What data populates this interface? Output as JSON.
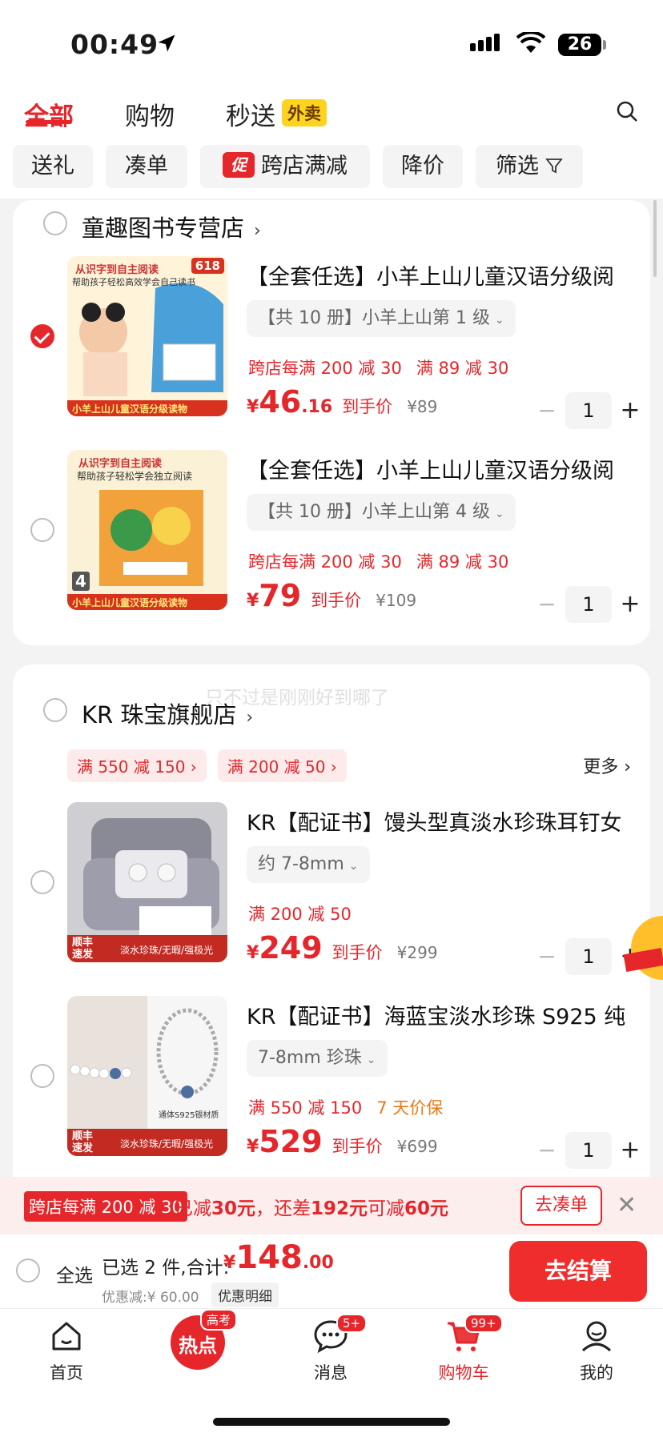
{
  "status_bar": {
    "time": "00:49",
    "battery": "26"
  },
  "tabs": [
    {
      "label": "全部",
      "active": true
    },
    {
      "label": "购物",
      "active": false
    },
    {
      "label": "秒送",
      "active": false
    }
  ],
  "waimai_badge": "外卖",
  "filters": [
    "送礼",
    "凑单",
    "跨店满减",
    "降价",
    "筛选"
  ],
  "promo_icon": "促",
  "watermark": "只不过是刚刚好到哪了",
  "shops": [
    {
      "name": "童趣图书专营店",
      "products": [
        {
          "checked": true,
          "title": "【全套任选】小羊上山儿童汉语分级阅",
          "spec": "【共 10 册】小羊上山第 1 级",
          "promo": "跨店每满 200 减 30",
          "promo2": "满 89 减 30",
          "price_yen": "¥",
          "price_int": "46",
          "price_dec": ".16",
          "price_label": "到手价",
          "orig_price": "¥89",
          "qty": "1",
          "thumb_badge": "618",
          "thumb_top": "从识字到自主阅读",
          "thumb_sub": "帮助孩子轻松高效学会自己读书",
          "thumb_banner": "小羊上山儿童汉语分级读物"
        },
        {
          "checked": false,
          "title": "【全套任选】小羊上山儿童汉语分级阅",
          "spec": "【共 10 册】小羊上山第 4 级",
          "promo": "跨店每满 200 减 30",
          "promo2": "满 89 减 30",
          "price_yen": "¥",
          "price_int": "79",
          "price_dec": "",
          "price_label": "到手价",
          "orig_price": "¥109",
          "qty": "1",
          "thumb_top": "从识字到自主阅读",
          "thumb_sub": "帮助孩子轻松学会独立阅读",
          "thumb_level": "4",
          "thumb_banner": "小羊上山儿童汉语分级读物"
        }
      ]
    },
    {
      "name": "KR 珠宝旗舰店",
      "coupons": [
        "满 550 减 150",
        "满 200 减 50"
      ],
      "more": "更多",
      "products": [
        {
          "checked": false,
          "title": "KR【配证书】馒头型真淡水珍珠耳钉女",
          "spec": "约 7-8mm",
          "promo": "满 200 减 50",
          "promo2": "",
          "price_yen": "¥",
          "price_int": "249",
          "price_dec": "",
          "price_label": "到手价",
          "orig_price": "¥299",
          "qty": "1",
          "thumb_tag": "顺丰速发",
          "thumb_caption": "淡水珍珠/无暇/强极光"
        },
        {
          "checked": false,
          "title": "KR【配证书】海蓝宝淡水珍珠 S925 纯",
          "spec": "7-8mm 珍珠",
          "promo": "满 550 减 150",
          "promo2": "7 天价保",
          "price_yen": "¥",
          "price_int": "529",
          "price_dec": "",
          "price_label": "到手价",
          "orig_price": "¥699",
          "qty": "1",
          "thumb_tag": "顺丰速发",
          "thumb_caption": "淡水珍珠/无暇/强极光",
          "thumb_label": "通体S925银材质"
        }
      ]
    }
  ],
  "promo_bar": {
    "tag": "跨店每满 200 减 30",
    "msg_a": "已减",
    "msg_b": "30元",
    "msg_c": "，还差",
    "msg_d": "192元",
    "msg_e": "可减",
    "msg_f": "60元",
    "go": "去凑单"
  },
  "checkout": {
    "select_all": "全选",
    "selected": "已选 2 件,合计:",
    "yen": "¥",
    "total_int": "148",
    "total_dec": ".00",
    "discount": "优惠减:¥ 60.00",
    "detail": "优惠明细",
    "pay": "去结算"
  },
  "nav": [
    {
      "label": "首页",
      "icon": "home-icon"
    },
    {
      "label": "",
      "icon": "hot-icon",
      "badge": "高考",
      "hot_text": "热点"
    },
    {
      "label": "消息",
      "icon": "message-icon",
      "badge": "5+"
    },
    {
      "label": "购物车",
      "icon": "cart-icon",
      "badge": "99+",
      "active": true
    },
    {
      "label": "我的",
      "icon": "profile-icon"
    }
  ],
  "colors": {
    "accent": "#e5262b",
    "orange": "#e97a17"
  }
}
